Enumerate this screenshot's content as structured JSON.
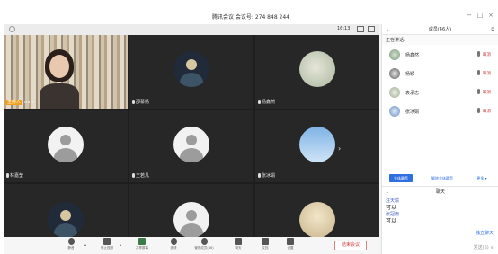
{
  "window": {
    "title": "腾讯会议 会议号: 274 848 244",
    "controls": [
      "−",
      "□",
      "×"
    ]
  },
  "video_bar": {
    "ratio": "16:13"
  },
  "tiles": [
    {
      "name": "mm",
      "host_tag": "主持人",
      "kind": "self"
    },
    {
      "name": "邵慕扬",
      "avatar": "night"
    },
    {
      "name": "杨鑫然",
      "avatar": "art"
    },
    {
      "name": "林嘉莹",
      "avatar": "default"
    },
    {
      "name": "王若凡",
      "avatar": "default"
    },
    {
      "name": "张冰娟",
      "avatar": "sky"
    },
    {
      "name": "",
      "avatar": "night"
    },
    {
      "name": "",
      "avatar": "default"
    },
    {
      "name": "",
      "avatar": "cream"
    }
  ],
  "toolbar": {
    "buttons": [
      {
        "label": "静音",
        "icon": "microphone-icon"
      },
      {
        "label": "停止视频",
        "icon": "video-camera-icon"
      },
      {
        "label": "共享屏幕",
        "icon": "screen-share-icon"
      },
      {
        "label": "邀请",
        "icon": "invite-icon"
      },
      {
        "label": "管理成员(46)",
        "icon": "members-icon"
      },
      {
        "label": "聊天",
        "icon": "chat-icon"
      },
      {
        "label": "文档",
        "icon": "document-icon"
      },
      {
        "label": "设置",
        "icon": "settings-icon"
      }
    ],
    "leave": "结束会议"
  },
  "panel": {
    "header": "成员(46人)",
    "section": "正在讲话:",
    "members": [
      {
        "name": "杨鑫然",
        "status": "取消",
        "avatar": "k1"
      },
      {
        "name": "杨颖",
        "status": "取消",
        "avatar": "k2"
      },
      {
        "name": "袁承志",
        "status": "取消",
        "avatar": "k3"
      },
      {
        "name": "张冰娟",
        "status": "取消",
        "avatar": "k4"
      }
    ],
    "actions": {
      "mute_all": "全体静音",
      "unmute_all": "解除全体静音",
      "more": "更多 ▾"
    },
    "chat": {
      "header": "聊天",
      "messages": [
        {
          "sender": "汪天瑜",
          "text": "可以"
        },
        {
          "sender": "张冠雨",
          "text": "可以"
        }
      ],
      "private_chat": "独立聊天",
      "send_to": "发送(S) ∨"
    }
  }
}
